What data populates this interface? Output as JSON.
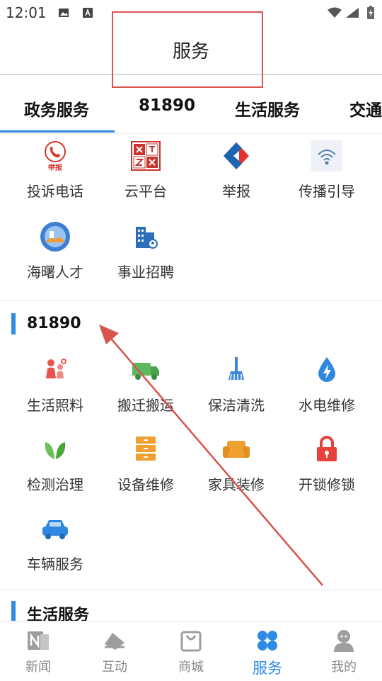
{
  "status_bar": {
    "time": "12:01"
  },
  "header": {
    "title": "服务"
  },
  "tabs": [
    {
      "label": "政务服务"
    },
    {
      "label": "81890"
    },
    {
      "label": "生活服务"
    },
    {
      "label": "交通"
    }
  ],
  "gov_services": {
    "items": [
      {
        "label": "投诉电话",
        "icon": "phone-report-icon"
      },
      {
        "label": "云平台",
        "icon": "wenming-seal-icon"
      },
      {
        "label": "举报",
        "icon": "report-logo-icon"
      },
      {
        "label": "传播引导",
        "icon": "broadcast-icon"
      },
      {
        "label": "海曙人才",
        "icon": "talent-badge-icon"
      },
      {
        "label": "事业招聘",
        "icon": "building-icon"
      }
    ],
    "icon_text": {
      "phone_badge": "举报",
      "seal": "文明实践"
    }
  },
  "section_81890": {
    "title": "81890",
    "items": [
      {
        "label": "生活照料",
        "icon": "family-care-icon"
      },
      {
        "label": "搬迁搬运",
        "icon": "truck-icon"
      },
      {
        "label": "保洁清洗",
        "icon": "broom-icon"
      },
      {
        "label": "水电维修",
        "icon": "water-electric-icon"
      },
      {
        "label": "检测治理",
        "icon": "leaf-icon"
      },
      {
        "label": "设备维修",
        "icon": "cabinet-icon"
      },
      {
        "label": "家具装修",
        "icon": "sofa-icon"
      },
      {
        "label": "开锁修锁",
        "icon": "lock-icon"
      },
      {
        "label": "车辆服务",
        "icon": "car-icon"
      }
    ]
  },
  "section_life": {
    "title": "生活服务"
  },
  "bottom_nav": [
    {
      "label": "新闻",
      "icon": "news-icon"
    },
    {
      "label": "互动",
      "icon": "interaction-icon"
    },
    {
      "label": "商城",
      "icon": "shopping-bag-icon"
    },
    {
      "label": "服务",
      "icon": "services-grid-icon",
      "active": true
    },
    {
      "label": "我的",
      "icon": "profile-icon"
    }
  ],
  "colors": {
    "accent": "#2e8be6",
    "annotation": "#d9534f",
    "inactive": "#888888"
  }
}
